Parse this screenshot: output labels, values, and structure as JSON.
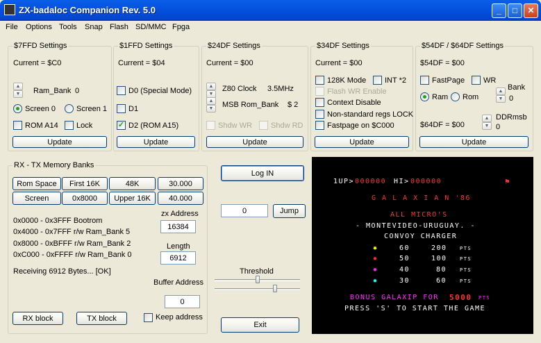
{
  "window": {
    "title": "ZX-badaloc Companion Rev. 5.0",
    "min": "_",
    "max": "□",
    "close": "✕"
  },
  "menu": [
    "File",
    "Options",
    "Tools",
    "Snap",
    "Flash",
    "SD/MMC",
    "Fpga"
  ],
  "g7ffd": {
    "title": "$7FFD Settings",
    "current": "Current =   $C0",
    "ram_bank": "Ram_Bank",
    "ram_bank_val": "0",
    "screen0": "Screen 0",
    "screen1": "Screen 1",
    "rom_a14": "ROM A14",
    "lock": "Lock",
    "update": "Update"
  },
  "g1ffd": {
    "title": "$1FFD Settings",
    "current": "Current =   $04",
    "d0": "D0 (Special Mode)",
    "d1": "D1",
    "d2": "D2 (ROM A15)",
    "update": "Update"
  },
  "g24df": {
    "title": "$24DF Settings",
    "current": "Current =   $00",
    "z80clock": "Z80 Clock",
    "z80clock_val": "3.5MHz",
    "msb_rom": "MSB Rom_Bank",
    "msb_rom_val": "$ 2",
    "shdw_wr": "Shdw WR",
    "shdw_rd": "Shdw RD",
    "update": "Update"
  },
  "g34df": {
    "title": "$34DF Settings",
    "current": "Current =   $00",
    "k128": "128K Mode",
    "int2": "INT *2",
    "flash_wr": "Flash WR Enable",
    "context": "Context Disable",
    "nonstd": "Non-standard regs LOCK",
    "fastpage": "Fastpage on $C000",
    "update": "Update"
  },
  "g54df": {
    "title": "$54DF / $64DF Settings",
    "current": "$54DF =   $00",
    "fastpage": "FastPage",
    "wr": "WR",
    "bank": "Bank",
    "bank_val": "0",
    "ram": "Ram",
    "rom": "Rom",
    "ddrmsb": "DDRmsb",
    "ddrmsb_val": "0",
    "current64": "$64DF =   $00",
    "update": "Update"
  },
  "rxtx": {
    "title": "RX - TX Memory Banks",
    "buttons": [
      "Rom Space",
      "First 16K",
      "48K",
      "30.000",
      "Screen",
      "0x8000",
      "Upper 16K",
      "40.000"
    ],
    "map": [
      "0x0000 - 0x3FFF Bootrom",
      "0x4000 - 0x7FFF r/w  Ram_Bank 5",
      "0x8000 - 0xBFFF r/w  Ram_Bank 2",
      "0xC000 - 0xFFFF r/w  Ram_Bank 0"
    ],
    "zx_address_label": "zx Address",
    "zx_address": "16384",
    "length_label": "Length",
    "length": "6912",
    "status": "Receiving 6912 Bytes... [OK]",
    "buffer_label": "Buffer Address",
    "buffer": "0",
    "rx_block": "RX block",
    "tx_block": "TX block",
    "keep_address": "Keep address"
  },
  "controls": {
    "log_in": "Log IN",
    "jump_value": "0",
    "jump": "Jump",
    "threshold": "Threshold",
    "exit": "Exit"
  },
  "screen": {
    "line1_1up": "1UP>",
    "line1_score": "000000",
    "line1_hi": "HI>",
    "line1_hiscore": "000000",
    "title": "G A L A X I A N '86",
    "line_all": "ALL MICRO'S",
    "line_mv": "- MONTEVIDEO-URUGUAY. -",
    "line_convoy": "CONVOY  CHARGER",
    "scores": [
      [
        "60",
        "200",
        "PTS"
      ],
      [
        "50",
        "100",
        "PTS"
      ],
      [
        "40",
        "80",
        "PTS"
      ],
      [
        "30",
        "60",
        "PTS"
      ]
    ],
    "bonus_text": "BONUS GALAXIP FOR",
    "bonus_val": "5000",
    "bonus_pts": "PTS",
    "press": "PRESS 'S' TO START THE GAME"
  }
}
